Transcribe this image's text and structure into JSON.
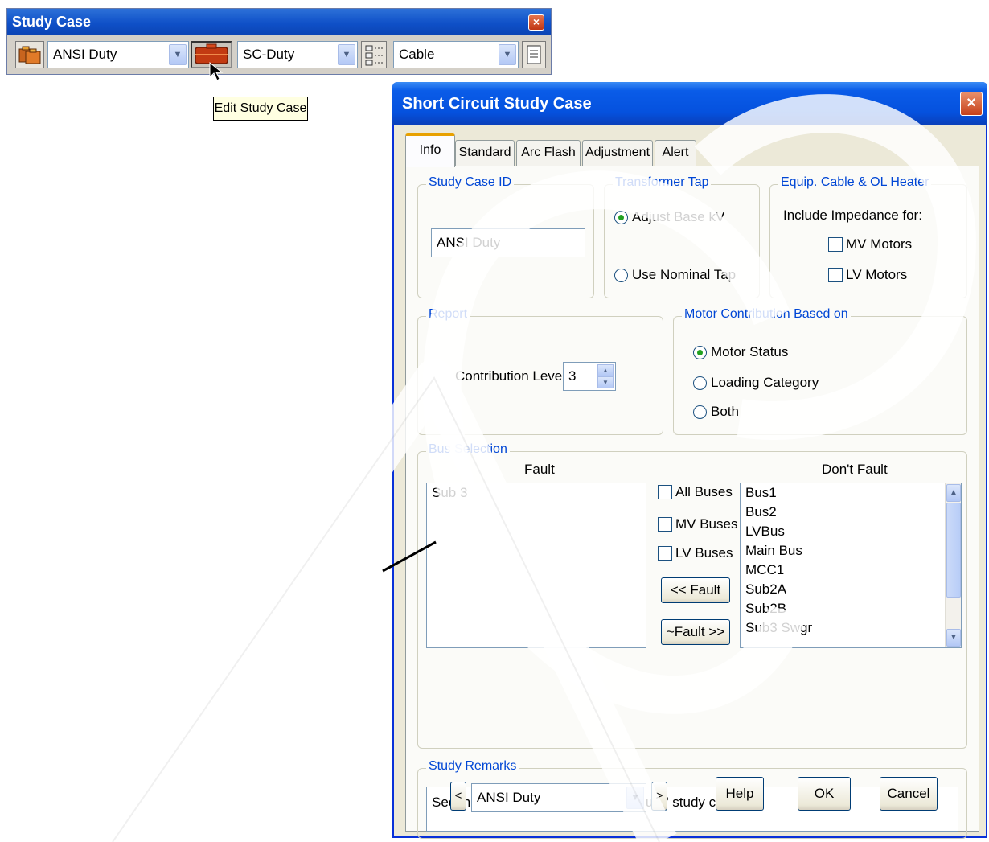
{
  "toolbar": {
    "title": "Study Case",
    "close_glyph": "×",
    "combo1_value": "ANSI Duty",
    "combo2_value": "SC-Duty",
    "combo3_value": "Cable",
    "tooltip": "Edit Study Case"
  },
  "dialog": {
    "title": "Short Circuit Study Case",
    "close_glyph": "×",
    "tabs": [
      "Info",
      "Standard",
      "Arc Flash",
      "Adjustment",
      "Alert"
    ],
    "study_case_id": {
      "label": "Study Case ID",
      "value": "ANSI Duty"
    },
    "transformer_tap": {
      "label": "Transformer Tap",
      "option1": "Adjust Base kV",
      "option2": "Use Nominal Tap",
      "selected": "Adjust Base kV"
    },
    "equip_cable": {
      "label": "Equip. Cable & OL Heater",
      "include_label": "Include Impedance for:",
      "mv_motors": "MV Motors",
      "lv_motors": "LV Motors"
    },
    "report": {
      "label": "Report",
      "contribution_label": "Contribution Level",
      "contribution_value": "3"
    },
    "motor_contribution": {
      "label": "Motor Contribution Based on",
      "option1": "Motor Status",
      "option2": "Loading Category",
      "option3": "Both",
      "selected": "Motor Status"
    },
    "bus_selection": {
      "label": "Bus Selection",
      "fault_header": "Fault",
      "dont_fault_header": "Don't Fault",
      "fault_items": [
        "Sub 3"
      ],
      "all_buses": "All Buses",
      "mv_buses": "MV Buses",
      "lv_buses": "LV Buses",
      "fault_button": "<< Fault",
      "unfault_button": "~Fault >>",
      "dont_fault_items": [
        "Bus1",
        "Bus2",
        "LVBus",
        "Main Bus",
        "MCC1",
        "Sub2A",
        "Sub2B",
        "Sub3 Swgr"
      ]
    },
    "study_remarks": {
      "label": "Study Remarks",
      "value": "Second line of remarks for \"ANSI Duty\" study case."
    },
    "footer": {
      "prev_glyph": "<",
      "next_glyph": ">",
      "case_value": "ANSI Duty",
      "help": "Help",
      "ok": "OK",
      "cancel": "Cancel"
    }
  },
  "colors": {
    "title_bar": "#0551de",
    "group_label": "#0046d5",
    "radio_dot": "#21a121",
    "dialog_bg": "#ece9d8"
  }
}
